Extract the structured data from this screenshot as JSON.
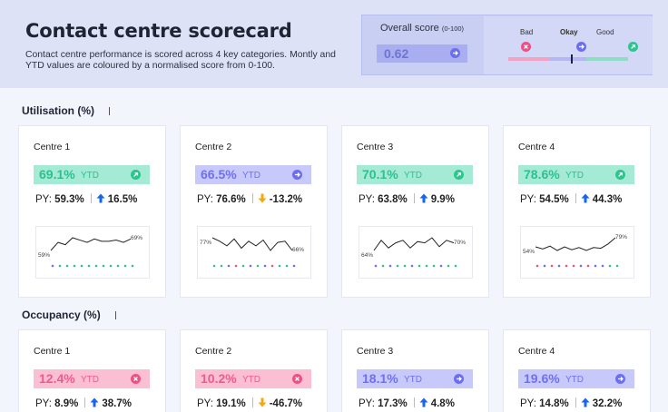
{
  "header": {
    "title": "Contact centre scorecard",
    "subtitle": "Contact centre performance is scored across 4 key categories. Montly and YTD values are coloured by a normalised score from 0-100.",
    "overall_label": "Overall score",
    "overall_label_small": "(0-100)",
    "overall_value": "0.62",
    "scale": {
      "bad": "Bad",
      "okay": "Okay",
      "good": "Good"
    }
  },
  "colors": {
    "good_bg": "#a5ead4",
    "good_fg": "#2fbf8e",
    "good_icon": "#2ec48e",
    "okay_bg": "#c8c9fb",
    "okay_fg": "#6f6ff0",
    "okay_icon": "#6c6ef2",
    "bad_bg": "#fbbfd3",
    "bad_fg": "#ee5b8c",
    "bad_icon": "#ef4f86",
    "up_arrow": "#1466f0",
    "down_arrow": "#f5a80c"
  },
  "sections": [
    {
      "title": "Utilisation (%)",
      "cards": [
        {
          "name": "Centre 1",
          "ytd": "69.1%",
          "ytd_label": "YTD",
          "status": "good",
          "py_label": "PY:",
          "py": "59.3%",
          "change": "16.5%",
          "direction": "up",
          "spark": {
            "start": "59%",
            "end": "69%",
            "values": [
              59,
              66,
              64,
              70,
              68,
              66,
              69,
              67,
              67,
              68,
              66,
              69
            ],
            "dots": [
              "okay",
              "good",
              "good",
              "good",
              "good",
              "good",
              "good",
              "good",
              "good",
              "good",
              "good",
              "good"
            ]
          }
        },
        {
          "name": "Centre 2",
          "ytd": "66.5%",
          "ytd_label": "YTD",
          "status": "okay",
          "py_label": "PY:",
          "py": "76.6%",
          "change": "-13.2%",
          "direction": "down",
          "spark": {
            "start": "77%",
            "end": "66%",
            "values": [
              77,
              74,
              70,
              76,
              68,
              74,
              70,
              75,
              66,
              73,
              74,
              66
            ],
            "dots": [
              "good",
              "good",
              "okay",
              "bad",
              "good",
              "okay",
              "good",
              "okay",
              "bad",
              "good",
              "good",
              "okay"
            ]
          }
        },
        {
          "name": "Centre 3",
          "ytd": "70.1%",
          "ytd_label": "YTD",
          "status": "good",
          "py_label": "PY:",
          "py": "63.8%",
          "change": "9.9%",
          "direction": "up",
          "spark": {
            "start": "64%",
            "end": "70%",
            "values": [
              64,
              72,
              66,
              70,
              72,
              66,
              71,
              70,
              74,
              67,
              72,
              70
            ],
            "dots": [
              "okay",
              "good",
              "okay",
              "good",
              "good",
              "okay",
              "good",
              "good",
              "good",
              "okay",
              "good",
              "good"
            ]
          }
        },
        {
          "name": "Centre 4",
          "ytd": "78.6%",
          "ytd_label": "YTD",
          "status": "good",
          "py_label": "PY:",
          "py": "54.5%",
          "change": "44.3%",
          "direction": "up",
          "spark": {
            "start": "54%",
            "end": "79%",
            "values": [
              54,
              48,
              56,
              44,
              54,
              46,
              52,
              44,
              52,
              50,
              62,
              79
            ],
            "dots": [
              "bad",
              "okay",
              "bad",
              "okay",
              "bad",
              "bad",
              "okay",
              "bad",
              "okay",
              "okay",
              "good",
              "good"
            ]
          }
        }
      ]
    },
    {
      "title": "Occupancy (%)",
      "cards": [
        {
          "name": "Centre 1",
          "ytd": "12.4%",
          "ytd_label": "YTD",
          "status": "bad",
          "py_label": "PY:",
          "py": "8.9%",
          "change": "38.7%",
          "direction": "up"
        },
        {
          "name": "Centre 2",
          "ytd": "10.2%",
          "ytd_label": "YTD",
          "status": "bad",
          "py_label": "PY:",
          "py": "19.1%",
          "change": "-46.7%",
          "direction": "down"
        },
        {
          "name": "Centre 3",
          "ytd": "18.1%",
          "ytd_label": "YTD",
          "status": "okay",
          "py_label": "PY:",
          "py": "17.3%",
          "change": "4.8%",
          "direction": "up"
        },
        {
          "name": "Centre 4",
          "ytd": "19.6%",
          "ytd_label": "YTD",
          "status": "okay",
          "py_label": "PY:",
          "py": "14.8%",
          "change": "32.2%",
          "direction": "up"
        }
      ]
    }
  ]
}
